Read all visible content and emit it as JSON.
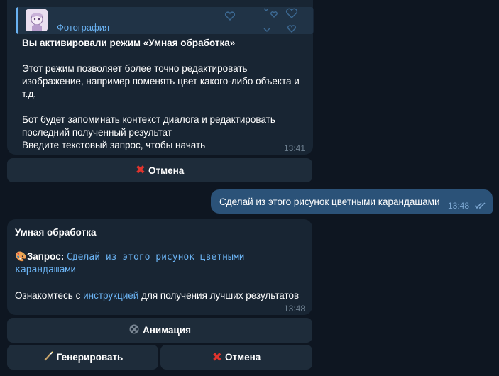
{
  "message1": {
    "reply_label": "Фотография",
    "title": "Вы активировали режим «Умная обработка»",
    "para1_line1": "Этот режим позволяет более точно редактировать",
    "para1_line2": "изображение, например поменять цвет какого-либо объекта и",
    "para1_line3": "т.д.",
    "para2_line1": "Бот будет запоминать контекст диалога и редактировать",
    "para2_line2": "последний полученный результат",
    "para2_line3": "Введите текстовый запрос, чтобы начать",
    "time": "13:41"
  },
  "keyboard1": {
    "cancel_label": "Отмена",
    "cancel_icon": "red-x-icon"
  },
  "user_message": {
    "text": "Сделай из этого рисунок цветными карандашами",
    "time": "13:48",
    "status_icon": "double-check-icon"
  },
  "message2": {
    "title": "Умная обработка",
    "query_icon": "palette-icon",
    "query_label": "Запрос:",
    "query_line1": "Сделай из этого рисунок цветными",
    "query_line2": "карандашами",
    "hint_before": "Ознакомтесь с ",
    "hint_link": "инструкцией",
    "hint_after": " для получения лучших результатов",
    "time": "13:48"
  },
  "keyboard2": {
    "animation_label": "Анимация",
    "animation_icon": "film-reel-icon",
    "generate_label": "Генерировать",
    "generate_icon": "magic-wand-icon",
    "cancel_label": "Отмена",
    "cancel_icon": "red-x-icon"
  },
  "colors": {
    "background": "#0e1621",
    "incoming_bubble": "#182533",
    "outgoing_bubble": "#2b5278",
    "button": "#1e2c3a",
    "accent": "#6ab2f2",
    "cancel_red": "#e0342d"
  }
}
